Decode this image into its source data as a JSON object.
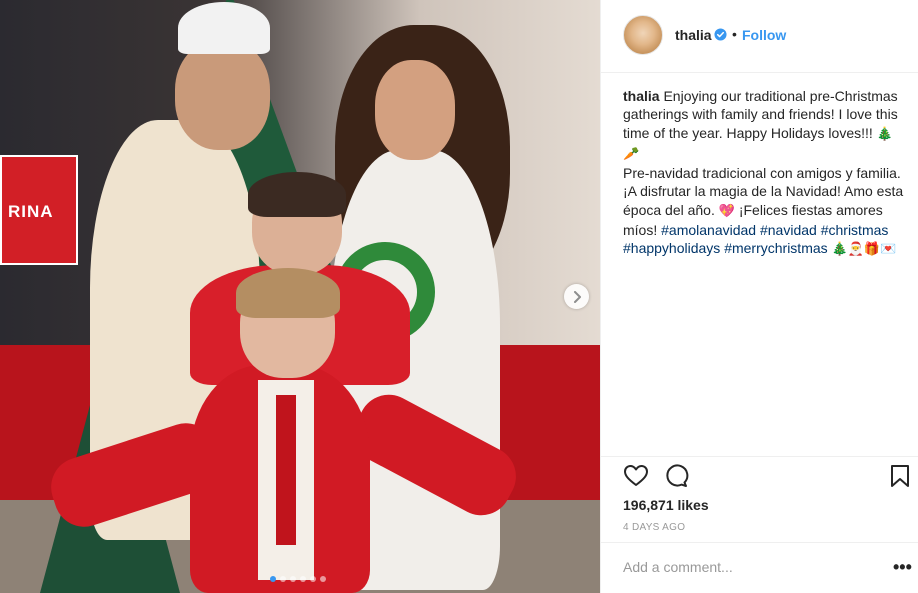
{
  "post": {
    "sign_text": "RINA",
    "carousel_pages": 6,
    "carousel_active": 1
  },
  "header": {
    "username": "thalia",
    "bullet": "•",
    "follow_label": "Follow"
  },
  "caption": {
    "username": "thalia",
    "line1": "Enjoying our traditional pre-Christmas gatherings with family and friends! I love this time of the year. Happy Holidays loves!!! ",
    "emoji1": "🎄🥕",
    "line2": "Pre-navidad tradicional con amigos y familia. ¡A disfrutar la magia de la Navidad! Amo esta época del año. ",
    "emoji2": "💖",
    "line3": " ¡Felices fiestas amores míos! ",
    "tag1": "#amolanavidad",
    "tag2": "#navidad",
    "tag3": "#christmas",
    "tag4": "#happyholidays",
    "tag5": "#merrychristmas",
    "emoji3": "🎄🎅🎁💌"
  },
  "stats": {
    "likes": "196,871 likes",
    "time_ago": "4 DAYS AGO"
  },
  "comment": {
    "placeholder": "Add a comment...",
    "more_label": "•••"
  },
  "colors": {
    "accent": "#3897f0",
    "hashtag": "#003569",
    "muted": "#999999",
    "border": "#efefef"
  },
  "icons": [
    "chevron-right-icon",
    "verified-badge-icon",
    "heart-icon",
    "comment-icon",
    "bookmark-icon",
    "more-options-icon"
  ]
}
